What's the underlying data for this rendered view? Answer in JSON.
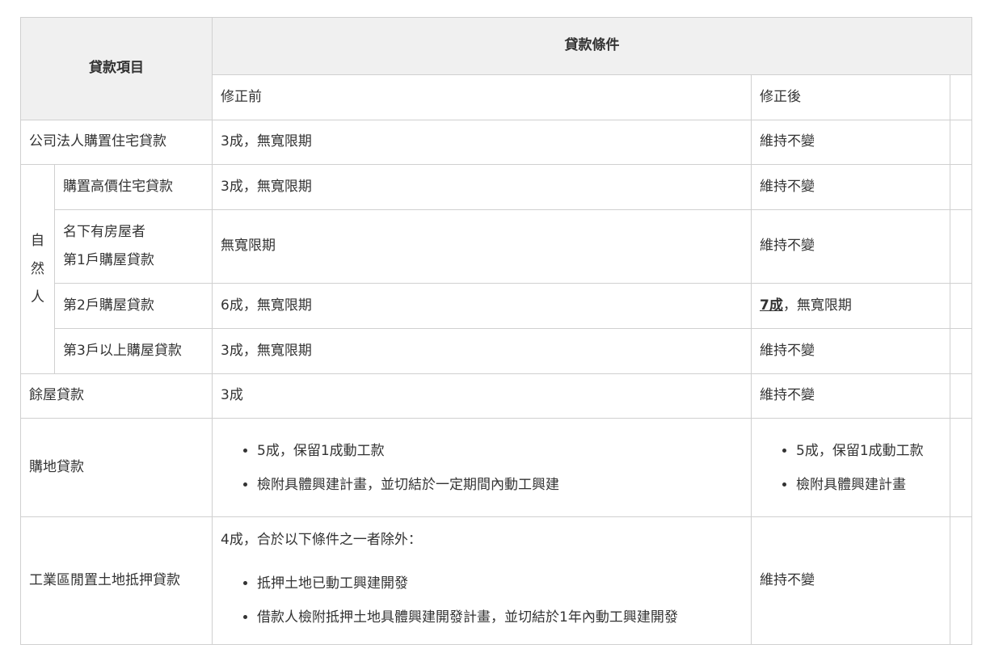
{
  "header": {
    "item_col": "貸款項目",
    "condition_col": "貸款條件",
    "before_col": "修正前",
    "after_col": "修正後"
  },
  "natural_person_group": [
    "自",
    "然",
    "人"
  ],
  "rows": {
    "corp": {
      "item": "公司法人購置住宅貸款",
      "before": "3成，無寬限期",
      "after": "維持不變"
    },
    "high_price": {
      "item": "購置高價住宅貸款",
      "before": "3成，無寬限期",
      "after": "維持不變"
    },
    "first_home": {
      "item_line1": "名下有房屋者",
      "item_line2": "第1戶購屋貸款",
      "before": "無寬限期",
      "after": "維持不變"
    },
    "second_home": {
      "item": "第2戶購屋貸款",
      "before": "6成，無寬限期",
      "after_emph": "7成",
      "after_rest": "，無寬限期"
    },
    "third_home": {
      "item": "第3戶以上購屋貸款",
      "before": "3成，無寬限期",
      "after": "維持不變"
    },
    "remaining": {
      "item": "餘屋貸款",
      "before": "3成",
      "after": "維持不變"
    },
    "land": {
      "item": "購地貸款",
      "before": [
        "5成，保留1成動工款",
        "檢附具體興建計畫，並切結於一定期間內動工興建"
      ],
      "after": [
        "5成，保留1成動工款",
        "檢附具體興建計畫"
      ]
    },
    "industrial": {
      "item": "工業區閒置土地抵押貸款",
      "before_lead": "4成，合於以下條件之一者除外：",
      "before": [
        "抵押土地已動工興建開發",
        "借款人檢附抵押土地具體興建開發計畫，並切結於1年內動工興建開發"
      ],
      "after": "維持不變"
    }
  }
}
